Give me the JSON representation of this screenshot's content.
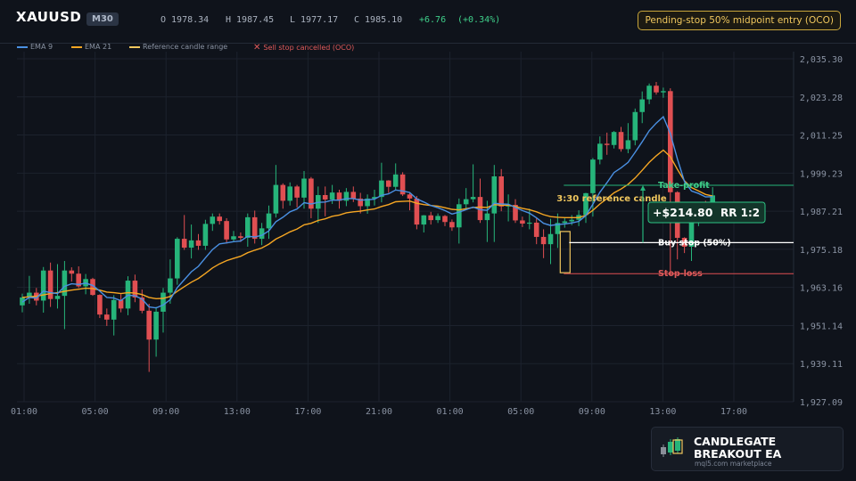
{
  "header": {
    "symbol": "XAUUSD",
    "timeframe": "M30",
    "open": "O 1978.34",
    "high": "H 1987.45",
    "low": "L 1977.17",
    "close": "C 1985.10",
    "change": "+6.76",
    "change_pct": "(+0.34%)",
    "status_pill": "Pending-stop 50% midpoint entry (OCO)"
  },
  "legend": [
    {
      "label": "EMA 9",
      "color": "#4a90e2"
    },
    {
      "label": "EMA 21",
      "color": "#f5a623"
    },
    {
      "label": "Reference candle range",
      "color": "#f0c75e"
    },
    {
      "label": "Sell stop cancelled (OCO)",
      "color": "#e05a5a"
    }
  ],
  "colors": {
    "bull": "#26b47a",
    "bear": "#e04f52",
    "background": "#0f131b",
    "grid": "#1c222d"
  },
  "chart_data": {
    "type": "candlestick",
    "y_ticks": [
      "2,035.30",
      "2,023.28",
      "2,011.25",
      "1,999.23",
      "1,987.21",
      "1,975.18",
      "1,963.16",
      "1,951.14",
      "1,939.11",
      "1,927.09"
    ],
    "ylim": [
      1927.09,
      2035.3
    ],
    "x_ticks": [
      "01:00",
      "05:00",
      "09:00",
      "13:00",
      "17:00",
      "21:00",
      "01:00",
      "05:00",
      "09:00",
      "13:00",
      "17:00"
    ],
    "candles": [
      [
        1957.5,
        1961.2,
        1955.3,
        1960.0
      ],
      [
        1960.0,
        1966.8,
        1958.0,
        1961.5
      ],
      [
        1961.5,
        1963.0,
        1957.5,
        1959.0
      ],
      [
        1959.0,
        1969.6,
        1955.2,
        1968.5
      ],
      [
        1968.5,
        1971.0,
        1957.0,
        1959.5
      ],
      [
        1959.5,
        1970.5,
        1956.5,
        1960.5
      ],
      [
        1960.5,
        1971.5,
        1950.0,
        1968.5
      ],
      [
        1968.5,
        1969.5,
        1965.0,
        1967.5
      ],
      [
        1967.5,
        1969.8,
        1963.0,
        1963.5
      ],
      [
        1963.5,
        1967.4,
        1961.0,
        1965.8
      ],
      [
        1965.8,
        1966.2,
        1960.5,
        1960.8
      ],
      [
        1960.8,
        1961.0,
        1953.5,
        1954.6
      ],
      [
        1954.6,
        1956.5,
        1951.0,
        1953.0
      ],
      [
        1953.0,
        1960.7,
        1948.0,
        1959.2
      ],
      [
        1959.2,
        1961.0,
        1955.3,
        1956.5
      ],
      [
        1956.5,
        1966.7,
        1954.4,
        1965.3
      ],
      [
        1965.3,
        1967.2,
        1958.5,
        1960.0
      ],
      [
        1960.0,
        1962.5,
        1955.0,
        1955.8
      ],
      [
        1955.8,
        1958.0,
        1936.5,
        1946.7
      ],
      [
        1946.7,
        1957.0,
        1941.3,
        1955.5
      ],
      [
        1955.5,
        1963.0,
        1948.9,
        1961.5
      ],
      [
        1961.5,
        1972.0,
        1958.0,
        1966.0
      ],
      [
        1966.0,
        1979.0,
        1964.0,
        1978.5
      ],
      [
        1978.5,
        1986.0,
        1975.0,
        1975.7
      ],
      [
        1975.7,
        1983.0,
        1972.3,
        1978.0
      ],
      [
        1978.0,
        1980.0,
        1975.0,
        1976.3
      ],
      [
        1976.3,
        1984.5,
        1975.0,
        1983.2
      ],
      [
        1983.2,
        1986.5,
        1981.0,
        1985.5
      ],
      [
        1985.5,
        1986.5,
        1983.0,
        1984.1
      ],
      [
        1984.1,
        1985.0,
        1977.0,
        1978.3
      ],
      [
        1978.3,
        1981.0,
        1977.5,
        1979.3
      ],
      [
        1979.3,
        1980.5,
        1977.5,
        1978.8
      ],
      [
        1978.8,
        1986.5,
        1976.0,
        1985.3
      ],
      [
        1985.3,
        1987.4,
        1977.0,
        1978.5
      ],
      [
        1978.5,
        1983.5,
        1976.5,
        1981.8
      ],
      [
        1981.8,
        1989.0,
        1978.5,
        1986.5
      ],
      [
        1986.5,
        2001.8,
        1985.2,
        1995.5
      ],
      [
        1995.5,
        1996.0,
        1988.0,
        1990.5
      ],
      [
        1990.5,
        1996.3,
        1989.0,
        1995.0
      ],
      [
        1995.0,
        1995.5,
        1988.4,
        1991.5
      ],
      [
        1991.5,
        1999.9,
        1988.0,
        1997.5
      ],
      [
        1997.5,
        1998.0,
        1985.0,
        1988.0
      ],
      [
        1988.0,
        1995.0,
        1983.5,
        1992.3
      ],
      [
        1992.3,
        1995.0,
        1985.6,
        1990.9
      ],
      [
        1990.9,
        1995.5,
        1989.5,
        1993.1
      ],
      [
        1993.1,
        1994.0,
        1988.0,
        1990.5
      ],
      [
        1990.5,
        1994.5,
        1988.8,
        1993.3
      ],
      [
        1993.3,
        1995.0,
        1990.1,
        1991.2
      ],
      [
        1991.2,
        1993.0,
        1986.5,
        1988.8
      ],
      [
        1988.8,
        1992.5,
        1986.4,
        1991.2
      ],
      [
        1991.2,
        1994.0,
        1989.0,
        1991.7
      ],
      [
        1991.7,
        2002.5,
        1990.0,
        1996.9
      ],
      [
        1996.9,
        1997.0,
        1993.0,
        1994.9
      ],
      [
        1994.9,
        2002.3,
        1993.8,
        1998.8
      ],
      [
        1998.8,
        1999.5,
        1992.0,
        1992.5
      ],
      [
        1992.5,
        1993.0,
        1987.5,
        1991.2
      ],
      [
        1991.2,
        1992.0,
        1981.5,
        1983.0
      ],
      [
        1983.0,
        1986.0,
        1980.5,
        1985.9
      ],
      [
        1985.9,
        1987.0,
        1983.0,
        1984.4
      ],
      [
        1984.4,
        1986.5,
        1983.5,
        1985.7
      ],
      [
        1985.7,
        1986.0,
        1982.5,
        1983.8
      ],
      [
        1983.8,
        1984.6,
        1981.0,
        1982.1
      ],
      [
        1982.1,
        1991.2,
        1977.0,
        1989.4
      ],
      [
        1989.4,
        1994.5,
        1988.0,
        1991.0
      ],
      [
        1991.0,
        2002.0,
        1990.0,
        1991.7
      ],
      [
        1991.7,
        1997.5,
        1983.5,
        1984.4
      ],
      [
        1984.4,
        1990.5,
        1977.5,
        1986.5
      ],
      [
        1986.5,
        2001.8,
        1977.5,
        1998.2
      ],
      [
        1998.2,
        2000.5,
        1987.2,
        1988.7
      ],
      [
        1988.7,
        1992.5,
        1984.0,
        1989.2
      ],
      [
        1989.2,
        1991.0,
        1983.5,
        1984.3
      ],
      [
        1984.3,
        1985.5,
        1982.2,
        1983.3
      ],
      [
        1983.3,
        1988.0,
        1981.5,
        1983.6
      ],
      [
        1983.6,
        1985.0,
        1976.8,
        1979.1
      ],
      [
        1979.1,
        1981.5,
        1972.4,
        1976.8
      ],
      [
        1976.8,
        1984.8,
        1970.5,
        1980.0
      ],
      [
        1980.0,
        1986.5,
        1975.6,
        1983.5
      ],
      [
        1983.5,
        1985.0,
        1982.0,
        1984.0
      ],
      [
        1984.0,
        1986.0,
        1982.8,
        1984.5
      ],
      [
        1984.5,
        1987.5,
        1982.5,
        1986.0
      ],
      [
        1986.0,
        1993.0,
        1983.5,
        1992.9
      ],
      [
        1992.9,
        2004.0,
        1985.5,
        2003.5
      ],
      [
        2003.5,
        2010.8,
        2002.0,
        2008.5
      ],
      [
        2008.5,
        2012.0,
        2005.0,
        2008.1
      ],
      [
        2008.1,
        2012.5,
        2007.0,
        2012.2
      ],
      [
        2012.2,
        2013.8,
        2006.0,
        2006.8
      ],
      [
        2006.8,
        2015.0,
        2005.5,
        2009.6
      ],
      [
        2009.6,
        2019.6,
        2008.0,
        2018.5
      ],
      [
        2018.5,
        2025.0,
        2015.0,
        2022.5
      ],
      [
        2022.5,
        2027.5,
        2021.0,
        2026.8
      ],
      [
        2026.8,
        2028.0,
        2024.0,
        2024.7
      ],
      [
        2024.7,
        2026.2,
        2023.0,
        2025.1
      ],
      [
        2025.1,
        2026.0,
        1967.0,
        1993.2
      ],
      [
        1993.2,
        1993.5,
        1972.0,
        1978.8
      ],
      [
        1978.8,
        1979.0,
        1974.0,
        1976.0
      ],
      [
        1976.0,
        1990.0,
        1971.5,
        1984.0
      ],
      [
        1984.0,
        1989.5,
        1982.5,
        1989.0
      ],
      [
        1989.0,
        1990.5,
        1986.0,
        1987.3
      ],
      [
        1987.3,
        1994.8,
        1986.0,
        1992.2
      ]
    ],
    "ema9": [
      1958.5,
      1960.0,
      1959.8,
      1962.0,
      1961.5,
      1961.2,
      1963.5,
      1964.3,
      1964.1,
      1964.5,
      1963.8,
      1962.0,
      1960.0,
      1959.8,
      1959.0,
      1960.7,
      1960.5,
      1959.5,
      1957.0,
      1956.7,
      1957.6,
      1959.3,
      1963.1,
      1965.6,
      1968.1,
      1969.8,
      1972.5,
      1975.1,
      1976.9,
      1977.2,
      1977.6,
      1977.8,
      1979.3,
      1979.1,
      1979.6,
      1981.0,
      1983.9,
      1985.3,
      1987.0,
      1987.9,
      1989.9,
      1989.5,
      1990.0,
      1990.1,
      1990.7,
      1990.7,
      1991.2,
      1991.2,
      1990.7,
      1990.8,
      1991.0,
      1992.2,
      1992.7,
      1993.9,
      1993.6,
      1993.1,
      1991.1,
      1990.1,
      1989.0,
      1988.3,
      1987.4,
      1986.3,
      1986.9,
      1987.7,
      1988.5,
      1987.7,
      1987.5,
      1989.7,
      1989.5,
      1989.4,
      1988.4,
      1987.4,
      1986.6,
      1985.1,
      1983.4,
      1982.7,
      1983.0,
      1983.2,
      1983.5,
      1984.0,
      1985.8,
      1989.4,
      1993.2,
      1996.2,
      1999.4,
      2000.9,
      2002.6,
      2005.8,
      2009.1,
      2012.6,
      2015.0,
      2017.0,
      2011.7,
      2003.7,
      1996.6,
      1993.6,
      1992.8,
      1991.7,
      1991.8
    ],
    "ema21": [
      1960.0,
      1960.2,
      1960.4,
      1960.8,
      1961.2,
      1961.5,
      1961.9,
      1962.3,
      1962.6,
      1962.9,
      1962.8,
      1962.3,
      1961.7,
      1961.5,
      1961.2,
      1961.5,
      1961.4,
      1960.9,
      1960.0,
      1959.6,
      1959.7,
      1960.3,
      1961.9,
      1963.4,
      1964.8,
      1966.0,
      1967.6,
      1969.3,
      1970.6,
      1971.6,
      1972.3,
      1973.0,
      1974.1,
      1974.9,
      1975.6,
      1976.8,
      1978.4,
      1979.5,
      1980.7,
      1981.6,
      1982.9,
      1983.4,
      1984.3,
      1984.8,
      1985.6,
      1986.0,
      1986.7,
      1987.0,
      1987.2,
      1987.6,
      1987.9,
      1988.7,
      1989.3,
      1990.2,
      1990.3,
      1990.4,
      1989.7,
      1989.3,
      1989.0,
      1988.8,
      1988.3,
      1987.8,
      1987.6,
      1988.0,
      1988.4,
      1988.5,
      1988.4,
      1989.3,
      1989.1,
      1989.1,
      1988.7,
      1988.1,
      1987.7,
      1987.0,
      1986.1,
      1985.5,
      1985.3,
      1985.2,
      1985.2,
      1985.2,
      1985.9,
      1987.5,
      1989.5,
      1991.2,
      1993.0,
      1994.2,
      1995.7,
      1997.7,
      2000.1,
      2002.6,
      2004.7,
      2006.5,
      2004.4,
      2000.4,
      1996.8,
      1994.7,
      1993.6,
      1992.5,
      1992.0
    ]
  },
  "annotations": {
    "reference_candle": "3:30 reference candle",
    "take_profit": "Take-profit",
    "buy_stop": "Buy stop (50%)",
    "stop_loss": "Stop-loss",
    "pnl": "+$214.80",
    "rr": "RR 1:2",
    "take_profit_price": 1995.4,
    "buy_stop_price": 1977.3,
    "stop_loss_price": 1967.5,
    "ref_range": [
      1967.8,
      1980.8
    ]
  },
  "branding": {
    "name": "CANDLEGATE BREAKOUT EA",
    "url": "mql5.com marketplace"
  }
}
